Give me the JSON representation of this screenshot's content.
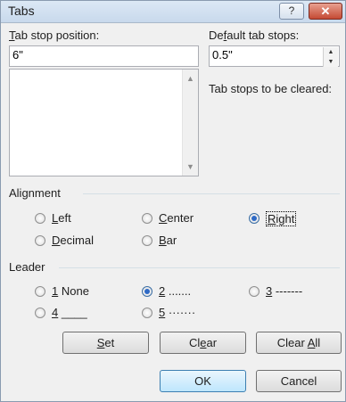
{
  "window": {
    "title": "Tabs",
    "help_glyph": "?",
    "close_glyph": "✕"
  },
  "tab_stop": {
    "label_pre": "",
    "label_key": "T",
    "label_post": "ab stop position:",
    "value": "6\"",
    "list_items": []
  },
  "default_tabs": {
    "label_pre": "De",
    "label_key": "f",
    "label_post": "ault tab stops:",
    "value": "0.5\""
  },
  "cleared": {
    "label": "Tab stops to be cleared:"
  },
  "alignment": {
    "heading": "Alignment",
    "options": [
      {
        "pre": "",
        "key": "L",
        "post": "eft",
        "checked": false
      },
      {
        "pre": "",
        "key": "C",
        "post": "enter",
        "checked": false
      },
      {
        "pre": "",
        "key": "R",
        "post": "ight",
        "checked": true
      },
      {
        "pre": "",
        "key": "D",
        "post": "ecimal",
        "checked": false
      },
      {
        "pre": "",
        "key": "B",
        "post": "ar",
        "checked": false
      }
    ]
  },
  "leader": {
    "heading": "Leader",
    "options": [
      {
        "key": "1",
        "post": " None",
        "checked": false
      },
      {
        "key": "2",
        "post": " .......",
        "checked": true
      },
      {
        "key": "3",
        "post": " -------",
        "checked": false
      },
      {
        "key": "4",
        "post": " ____",
        "checked": false
      },
      {
        "key": "5",
        "post": " ·······",
        "checked": false
      }
    ]
  },
  "buttons": {
    "set": {
      "pre": "",
      "key": "S",
      "post": "et"
    },
    "clear": {
      "pre": "Cl",
      "key": "e",
      "post": "ar"
    },
    "clear_all": {
      "pre": "Clear ",
      "key": "A",
      "post": "ll"
    },
    "ok": "OK",
    "cancel": "Cancel"
  }
}
